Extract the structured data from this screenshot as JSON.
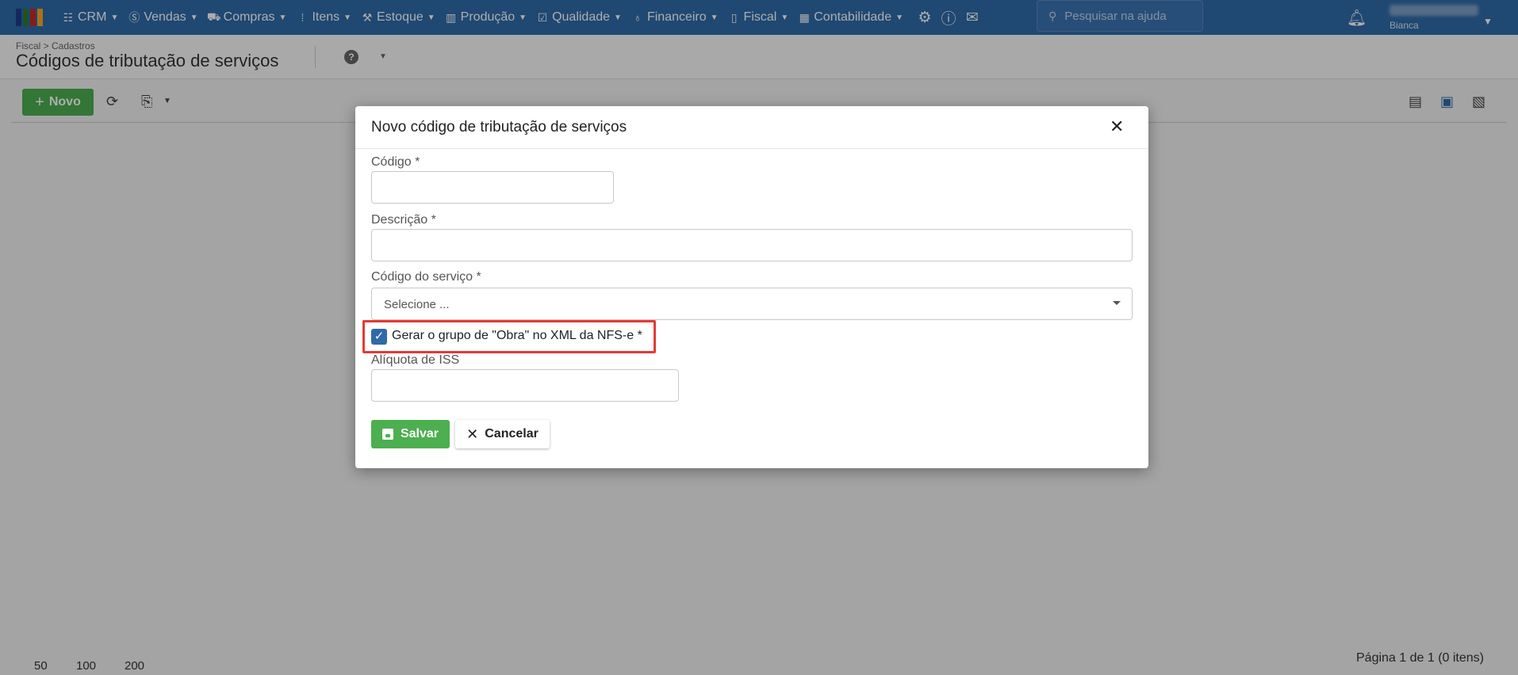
{
  "nav": {
    "items": [
      {
        "label": "CRM",
        "icon": "crm-icon"
      },
      {
        "label": "Vendas",
        "icon": "dollar-icon"
      },
      {
        "label": "Compras",
        "icon": "cart-icon"
      },
      {
        "label": "Itens",
        "icon": "grid-icon"
      },
      {
        "label": "Estoque",
        "icon": "box-icon"
      },
      {
        "label": "Produção",
        "icon": "factory-icon"
      },
      {
        "label": "Qualidade",
        "icon": "checklist-icon"
      },
      {
        "label": "Financeiro",
        "icon": "money-bag-icon"
      },
      {
        "label": "Fiscal",
        "icon": "document-icon"
      },
      {
        "label": "Contabilidade",
        "icon": "calculator-icon"
      }
    ],
    "search_placeholder": "Pesquisar na ajuda",
    "user_sub": "Bianca"
  },
  "header": {
    "breadcrumb": "Fiscal > Cadastros",
    "title": "Códigos de tributação de serviços"
  },
  "toolbar": {
    "new_label": "Novo"
  },
  "footer": {
    "page_sizes": [
      "50",
      "100",
      "200"
    ],
    "page_info": "Página 1 de 1 (0 itens)"
  },
  "modal": {
    "title": "Novo código de tributação de serviços",
    "fields": {
      "codigo_label": "Código *",
      "codigo_value": "",
      "descricao_label": "Descrição *",
      "descricao_value": "",
      "servico_label": "Código do serviço *",
      "servico_selected": "Selecione ...",
      "obra_checkbox_label": "Gerar o grupo de \"Obra\" no XML da NFS-e *",
      "obra_checked": true,
      "aliquota_label": "Alíquota de ISS",
      "aliquota_value": ""
    },
    "save_label": "Salvar",
    "cancel_label": "Cancelar"
  },
  "colors": {
    "primary": "#2f6aa8",
    "success": "#4caf50",
    "highlight": "#e53935"
  }
}
